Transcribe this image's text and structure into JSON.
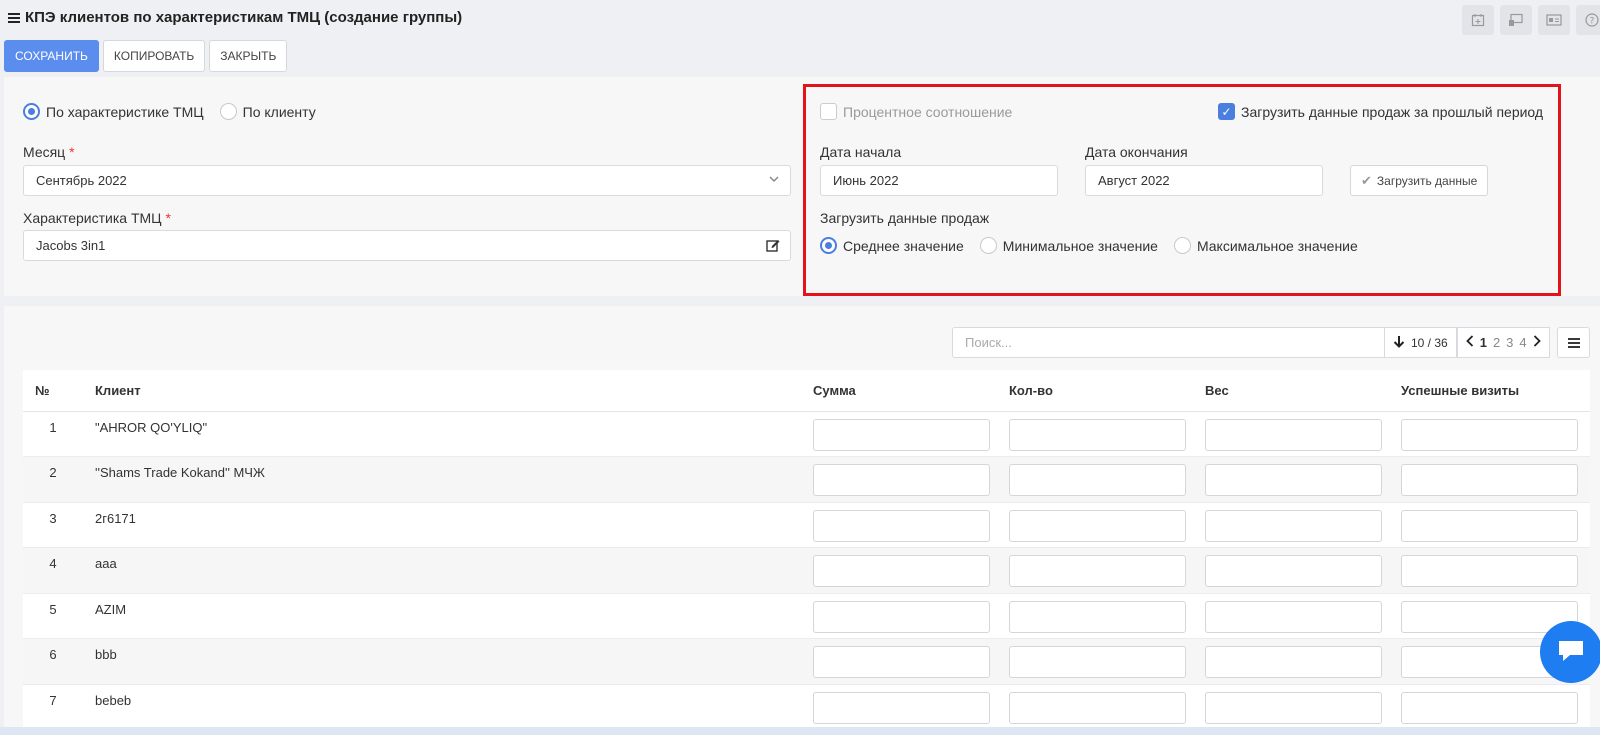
{
  "header": {
    "title": "КПЭ клиентов по характеристикам ТМЦ (создание группы)",
    "icons": [
      "calendar-icon",
      "monitor-icon",
      "id-card-icon",
      "help-icon"
    ]
  },
  "actions": {
    "save": "СОХРАНИТЬ",
    "copy": "КОПИРОВАТЬ",
    "close": "ЗАКРЫТЬ"
  },
  "mode": {
    "option1": "По характеристике ТМЦ",
    "option2": "По клиенту",
    "selected": "option1"
  },
  "month": {
    "label": "Месяц",
    "required": "*",
    "value": "Сентябрь 2022"
  },
  "characteristic": {
    "label": "Характеристика ТМЦ",
    "required": "*",
    "value": "Jacobs 3in1"
  },
  "options": {
    "percent_label": "Процентное соотношение",
    "percent_checked": false,
    "load_prev_label": "Загрузить данные продаж за прошлый период",
    "load_prev_checked": true
  },
  "dates": {
    "start_label": "Дата начала",
    "start_value": "Июнь 2022",
    "end_label": "Дата окончания",
    "end_value": "Август 2022",
    "load_button": "Загрузить данные"
  },
  "sales_mode": {
    "label": "Загрузить данные продаж",
    "avg": "Среднее значение",
    "min": "Минимальное значение",
    "max": "Максимальное значение",
    "selected": "avg"
  },
  "toolbar": {
    "search_placeholder": "Поиск...",
    "count": "10 / 36",
    "pages": [
      "1",
      "2",
      "3",
      "4"
    ],
    "current_page": "1"
  },
  "table": {
    "headers": [
      "№",
      "Клиент",
      "Сумма",
      "Кол-во",
      "Вес",
      "Успешные визиты"
    ],
    "rows": [
      {
        "n": "1",
        "client": "\"AHROR QO'YLIQ\""
      },
      {
        "n": "2",
        "client": "''Shams Trade Kokand'' МЧЖ"
      },
      {
        "n": "3",
        "client": "2г6171"
      },
      {
        "n": "4",
        "client": "aaa"
      },
      {
        "n": "5",
        "client": "AZIM"
      },
      {
        "n": "6",
        "client": "bbb"
      },
      {
        "n": "7",
        "client": "bebeb"
      }
    ]
  },
  "colors": {
    "primary": "#5b8def",
    "accent": "#4a7fe0",
    "highlight": "#e1141b",
    "chat": "#1e7df0"
  }
}
